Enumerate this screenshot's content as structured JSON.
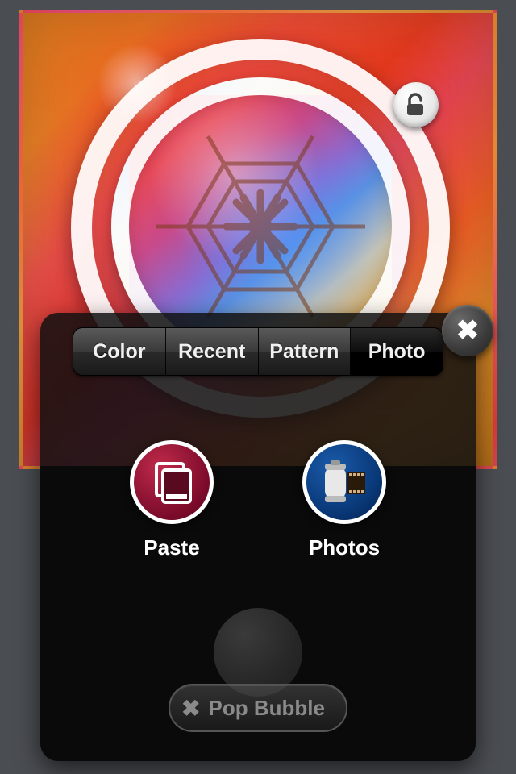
{
  "tabs": {
    "items": [
      {
        "label": "Color"
      },
      {
        "label": "Recent"
      },
      {
        "label": "Pattern"
      },
      {
        "label": "Photo"
      }
    ],
    "active_index": 3
  },
  "options": {
    "paste": {
      "label": "Paste"
    },
    "photos": {
      "label": "Photos"
    }
  },
  "footer": {
    "pop_label": "Pop Bubble"
  },
  "icons": {
    "close": "✖",
    "pop_close": "✖"
  }
}
